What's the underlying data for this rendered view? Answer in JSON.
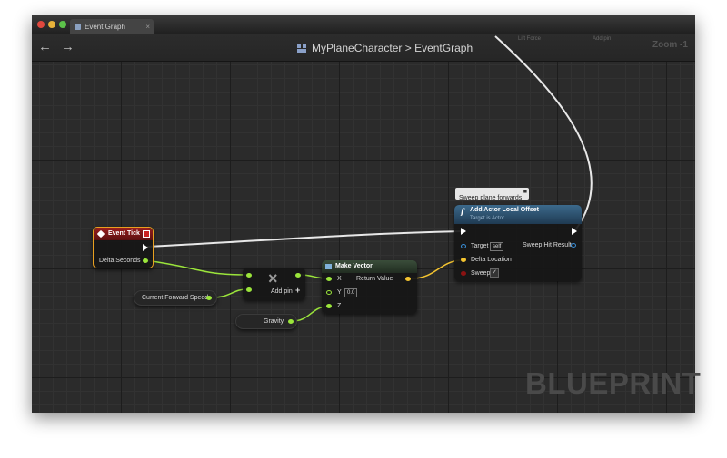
{
  "window": {
    "tab": {
      "label": "Event Graph"
    },
    "breadcrumb": {
      "asset": "MyPlaneCharacter",
      "separator": ">",
      "graph": "EventGraph"
    },
    "nav": {
      "back_glyph": "←",
      "forward_glyph": "→"
    }
  },
  "top_partial": {
    "left_label": "Lift Force",
    "add_pin": "Add pin",
    "zoom": "Zoom -1"
  },
  "nodes": {
    "event_tick": {
      "title": "Event Tick",
      "output": "Delta Seconds"
    },
    "current_speed": {
      "label": "Current Forward Speed"
    },
    "gravity": {
      "label": "Gravity"
    },
    "multiply": {
      "symbol": "×",
      "add_pin": "Add pin",
      "plus": "+"
    },
    "make_vector": {
      "title": "Make Vector",
      "inputs": [
        "X",
        "Y",
        "Z"
      ],
      "y_value": "0.0",
      "output": "Return Value"
    },
    "add_offset": {
      "comment": "Sweep plane forwards",
      "title": "Add Actor Local Offset",
      "subtitle": "Target is Actor",
      "target_label": "Target",
      "target_value": "self",
      "delta_label": "Delta Location",
      "sweep_label": "Sweep",
      "sweep_checked": true,
      "sweep_hit": "Sweep Hit Result"
    }
  },
  "watermark": "BLUEPRINT",
  "colors": {
    "exec": "#ffffff",
    "float_pin": "#9be53b",
    "vector_pin": "#f4c430",
    "object_pin": "#3a8fd8",
    "bool_pin": "#8b1212",
    "event_header": "#8b1a1a",
    "function_header": "#2c4a63",
    "make_vector_header": "#2a3b2a"
  }
}
